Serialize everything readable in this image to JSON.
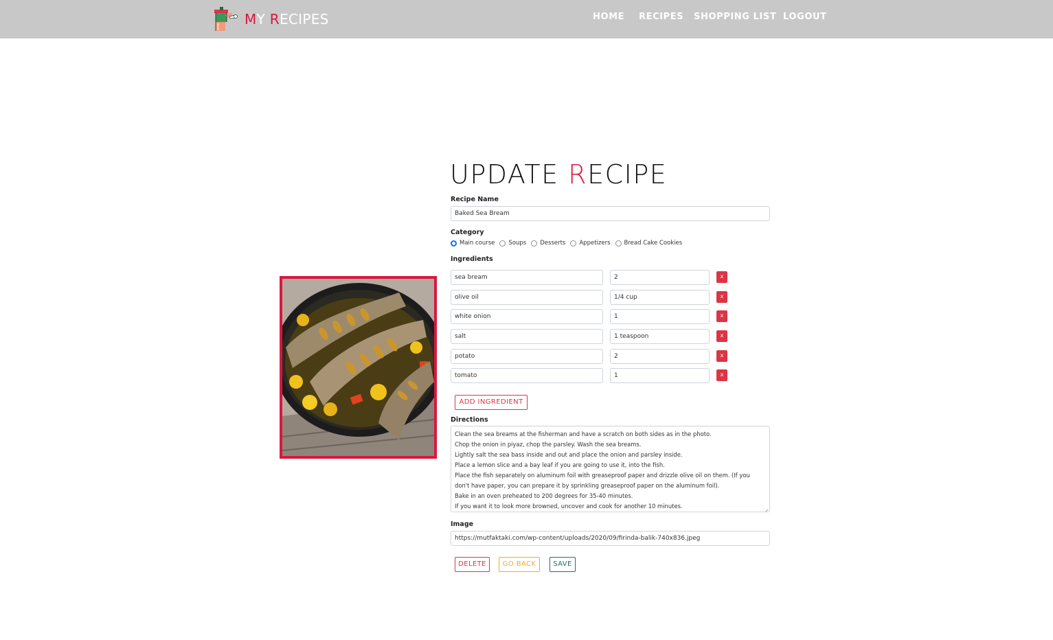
{
  "header": {
    "brand": {
      "first_letter": "M",
      "first_rest": "Y",
      "second_letter": "R",
      "second_rest": "ECIPES",
      "accent_color": "#d9173f",
      "muted_color": "#ffffff"
    },
    "nav": [
      {
        "label": "HOME"
      },
      {
        "label": "RECIPES"
      },
      {
        "label": "SHOPPING LIST"
      },
      {
        "label": "LOGOUT"
      }
    ]
  },
  "form": {
    "title_start": "UPDATE ",
    "title_accent": "R",
    "title_end": "ECIPE",
    "recipe_name_label": "Recipe Name",
    "recipe_name_value": "Baked Sea Bream",
    "category_label": "Category",
    "categories": [
      {
        "label": "Main course",
        "checked": true
      },
      {
        "label": "Soups",
        "checked": false
      },
      {
        "label": "Desserts",
        "checked": false
      },
      {
        "label": "Appetizers",
        "checked": false
      },
      {
        "label": "Bread Cake Cookies",
        "checked": false
      }
    ],
    "ingredients_label": "Ingredients",
    "ingredients": [
      {
        "name": "sea bream",
        "amount": "2",
        "remove": "x"
      },
      {
        "name": "olive oil",
        "amount": "1/4 cup",
        "remove": "x"
      },
      {
        "name": "white onion",
        "amount": "1",
        "remove": "x"
      },
      {
        "name": "salt",
        "amount": "1 teaspoon",
        "remove": "x"
      },
      {
        "name": "potato",
        "amount": "2",
        "remove": "x"
      },
      {
        "name": "tomato",
        "amount": "1",
        "remove": "x"
      }
    ],
    "add_ingredient_label": "ADD INGREDIENT",
    "directions_label": "Directions",
    "directions_lines": [
      "Clean the sea breams at the fisherman and have a scratch on both sides as in the photo.",
      "Chop the onion in piyaz, chop the parsley. Wash the sea breams.",
      "Lightly salt the sea bass inside and out and place the onion and parsley inside.",
      "Place a lemon slice and a bay leaf if you are going to use it, into the fish.",
      "Place the fish separately on aluminum foil with greaseproof paper and drizzle olive oil on them. (If you",
      "don't have paper, you can prepare it by sprinkling greaseproof paper on the aluminum foil).",
      "Bake in an oven preheated to 200 degrees for 35-40 minutes.",
      "If you want it to look more browned, uncover and cook for another 10 minutes."
    ],
    "image_label": "Image",
    "image_value": "https://mutfaktaki.com/wp-content/uploads/2020/09/firinda-balik-740x836.jpeg",
    "buttons": {
      "delete": "DELETE",
      "go_back": "GO BACK",
      "save": "SAVE"
    }
  },
  "colors": {
    "accent": "#d9173f",
    "navbar_bg": "#c8c8c8",
    "delete": "#dc3545",
    "go_back": "#f0ad1e",
    "save": "#1f6f6a",
    "radio_checked": "#0d6efd"
  },
  "icons": {
    "brand_logo": "chef-illustration-icon",
    "remove": "x-icon",
    "resize": "resize-grip-icon"
  }
}
